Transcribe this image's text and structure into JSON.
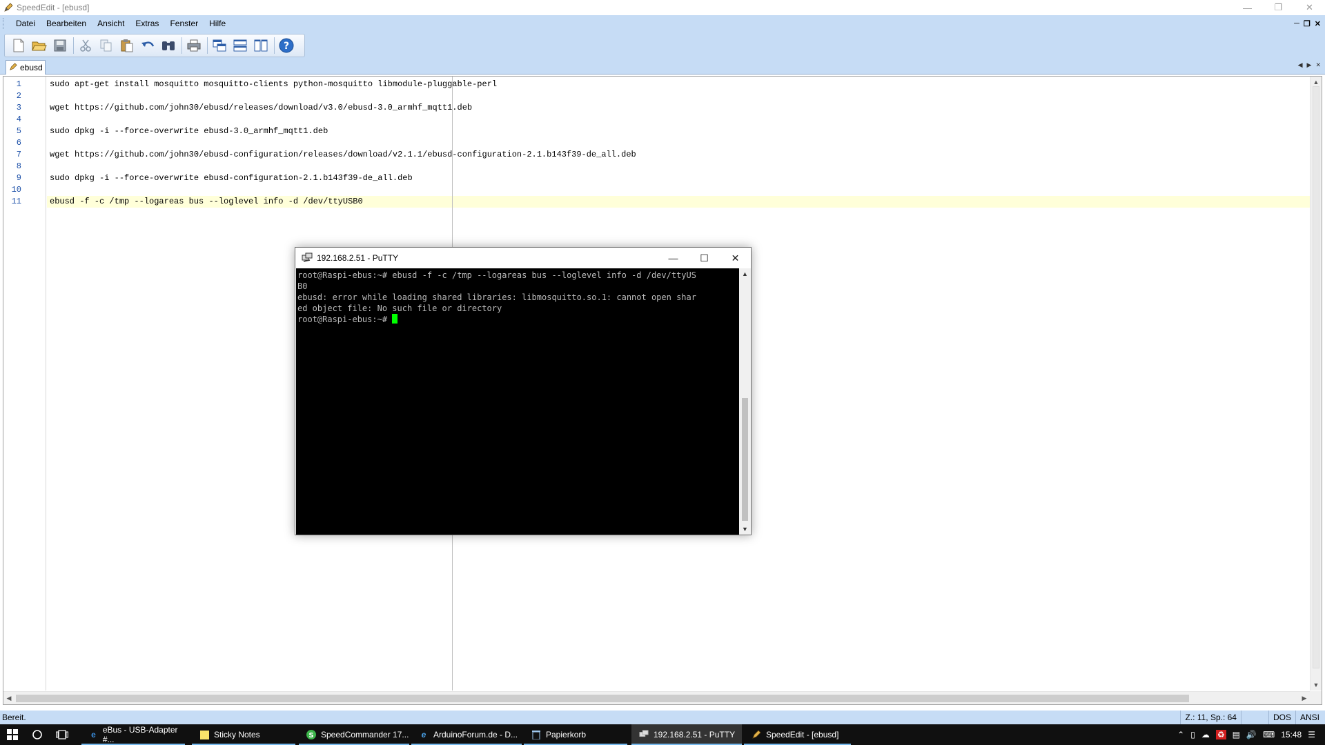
{
  "window": {
    "title": "SpeedEdit - [ebusd]"
  },
  "menu": [
    "Datei",
    "Bearbeiten",
    "Ansicht",
    "Extras",
    "Fenster",
    "Hilfe"
  ],
  "toolbar_icons": [
    "new-file-icon",
    "open-folder-icon",
    "save-icon",
    "cut-icon",
    "copy-icon",
    "paste-icon",
    "undo-icon",
    "find-icon",
    "print-icon",
    "window-cascade-icon",
    "split-horizontal-icon",
    "split-vertical-icon",
    "help-icon"
  ],
  "tab": {
    "label": "ebusd"
  },
  "editor": {
    "line_numbers": [
      "1",
      "2",
      "3",
      "4",
      "5",
      "6",
      "7",
      "8",
      "9",
      "10",
      "11"
    ],
    "lines": [
      "sudo apt-get install mosquitto mosquitto-clients python-mosquitto libmodule-pluggable-perl",
      "",
      "wget https://github.com/john30/ebusd/releases/download/v3.0/ebusd-3.0_armhf_mqtt1.deb",
      "",
      "sudo dpkg -i --force-overwrite ebusd-3.0_armhf_mqtt1.deb",
      "",
      "wget https://github.com/john30/ebusd-configuration/releases/download/v2.1.1/ebusd-configuration-2.1.b143f39-de_all.deb",
      "",
      "sudo dpkg -i --force-overwrite ebusd-configuration-2.1.b143f39-de_all.deb",
      "",
      "ebusd -f -c /tmp --logareas bus --loglevel info -d /dev/ttyUSB0"
    ],
    "current_line": 11
  },
  "status": {
    "ready": "Bereit.",
    "position": "Z.: 11, Sp.: 64",
    "line_ending": "DOS",
    "encoding": "ANSI"
  },
  "putty": {
    "title": "192.168.2.51 - PuTTY",
    "terminal_lines": [
      "root@Raspi-ebus:~# ebusd -f -c /tmp --logareas bus --loglevel info -d /dev/ttyUS",
      "B0",
      "ebusd: error while loading shared libraries: libmosquitto.so.1: cannot open shar",
      "ed object file: No such file or directory"
    ],
    "prompt": "root@Raspi-ebus:~# "
  },
  "taskbar": {
    "items": [
      {
        "label": "eBus - USB-Adapter #...",
        "icon": "edge-icon"
      },
      {
        "label": "Sticky Notes",
        "icon": "sticky-notes-icon"
      },
      {
        "label": "SpeedCommander 17...",
        "icon": "speedcommander-icon"
      },
      {
        "label": "ArduinoForum.de - D...",
        "icon": "ie-icon"
      },
      {
        "label": "Papierkorb",
        "icon": "recycle-bin-icon"
      },
      {
        "label": "192.168.2.51 - PuTTY",
        "icon": "putty-icon"
      },
      {
        "label": "SpeedEdit - [ebusd]",
        "icon": "speededit-icon"
      }
    ],
    "clock": "15:48"
  },
  "colors": {
    "chrome": "#c6dcf5",
    "current_line": "#ffffd9",
    "line_numbers": "#1b4fa8",
    "terminal_bg": "#000000",
    "cursor": "#00ff00",
    "taskbar": "#101010"
  }
}
